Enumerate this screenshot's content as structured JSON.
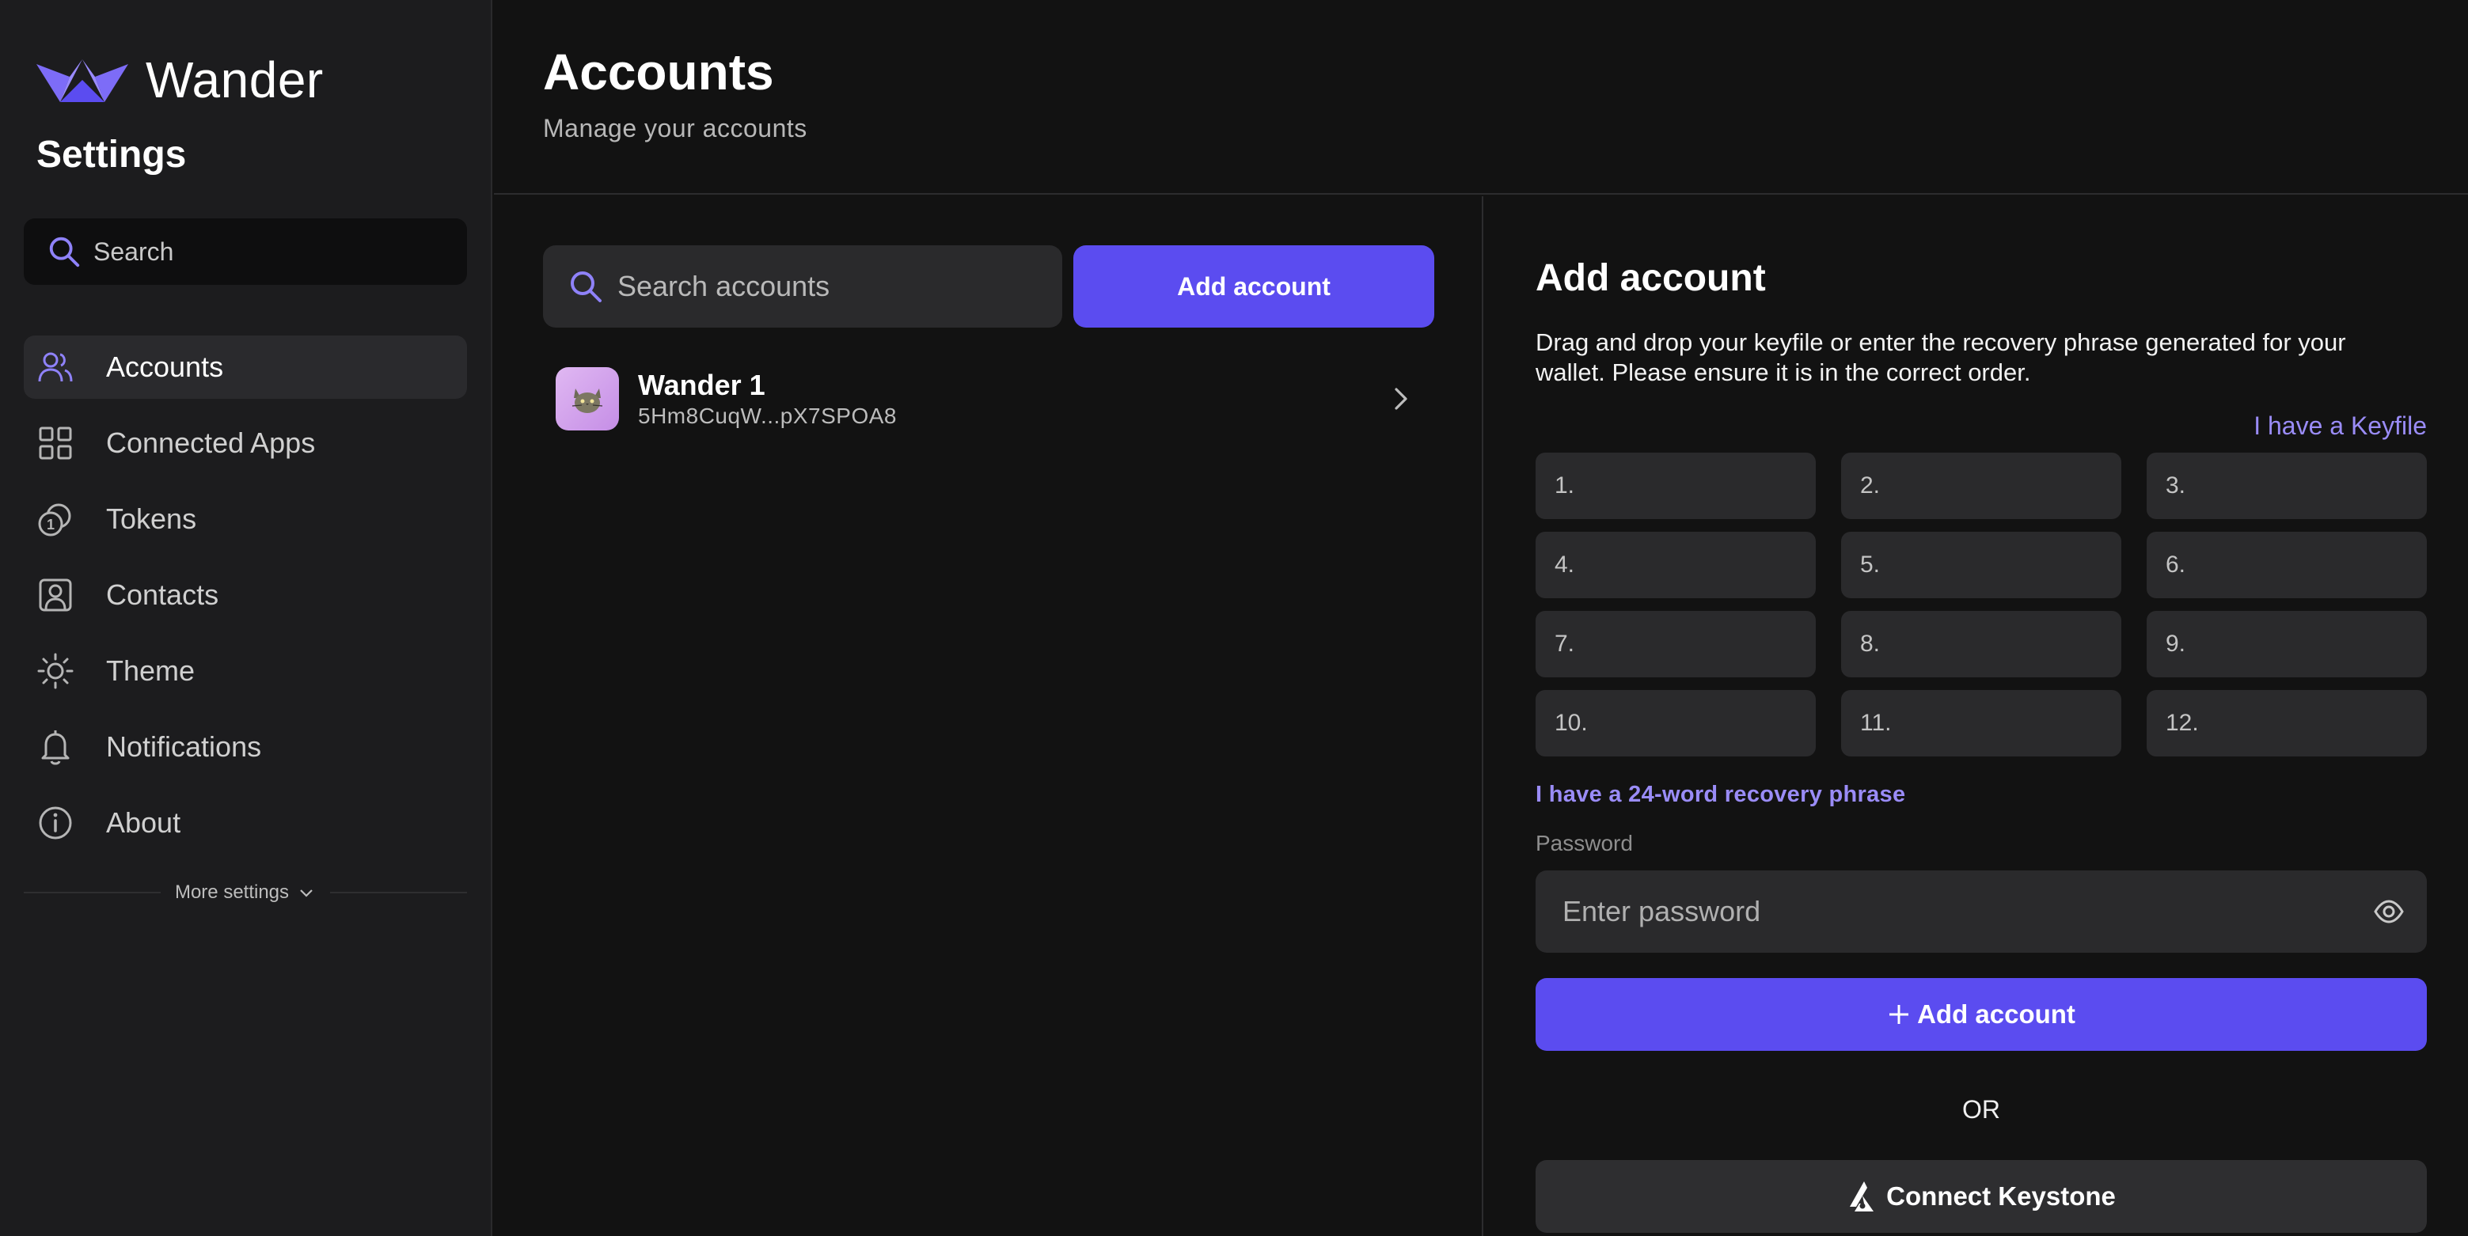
{
  "app": {
    "name": "Wander",
    "brand_color": "#6c5cf5"
  },
  "sidebar": {
    "title": "Settings",
    "search_placeholder": "Search",
    "items": [
      {
        "label": "Accounts",
        "icon": "users-icon",
        "active": true
      },
      {
        "label": "Connected Apps",
        "icon": "grid-icon",
        "active": false
      },
      {
        "label": "Tokens",
        "icon": "coins-icon",
        "active": false
      },
      {
        "label": "Contacts",
        "icon": "contact-card-icon",
        "active": false
      },
      {
        "label": "Theme",
        "icon": "sun-icon",
        "active": false
      },
      {
        "label": "Notifications",
        "icon": "bell-icon",
        "active": false
      },
      {
        "label": "About",
        "icon": "info-icon",
        "active": false
      }
    ],
    "more_settings": "More settings"
  },
  "header": {
    "title": "Accounts",
    "subtitle": "Manage your accounts"
  },
  "accounts_list": {
    "search_placeholder": "Search accounts",
    "add_button": "Add account",
    "accounts": [
      {
        "name": "Wander 1",
        "address": "5Hm8CuqW...pX7SPOA8"
      }
    ]
  },
  "add_account": {
    "title": "Add account",
    "description": "Drag and drop your keyfile or enter the recovery phrase generated for your wallet. Please ensure it is in the correct order.",
    "keyfile_link": "I have a Keyfile",
    "word_slots": [
      "1.",
      "2.",
      "3.",
      "4.",
      "5.",
      "6.",
      "7.",
      "8.",
      "9.",
      "10.",
      "11.",
      "12."
    ],
    "phrase_24_link": "I have a 24-word recovery phrase",
    "password_label": "Password",
    "password_placeholder": "Enter password",
    "submit_button": "Add account",
    "or_text": "OR",
    "keystone_button": "Connect Keystone"
  },
  "colors": {
    "accent": "#5b4cf0",
    "link": "#9a8cf7",
    "background": "#121212",
    "sidebar": "#1c1c1e",
    "field": "#2a2a2c"
  }
}
